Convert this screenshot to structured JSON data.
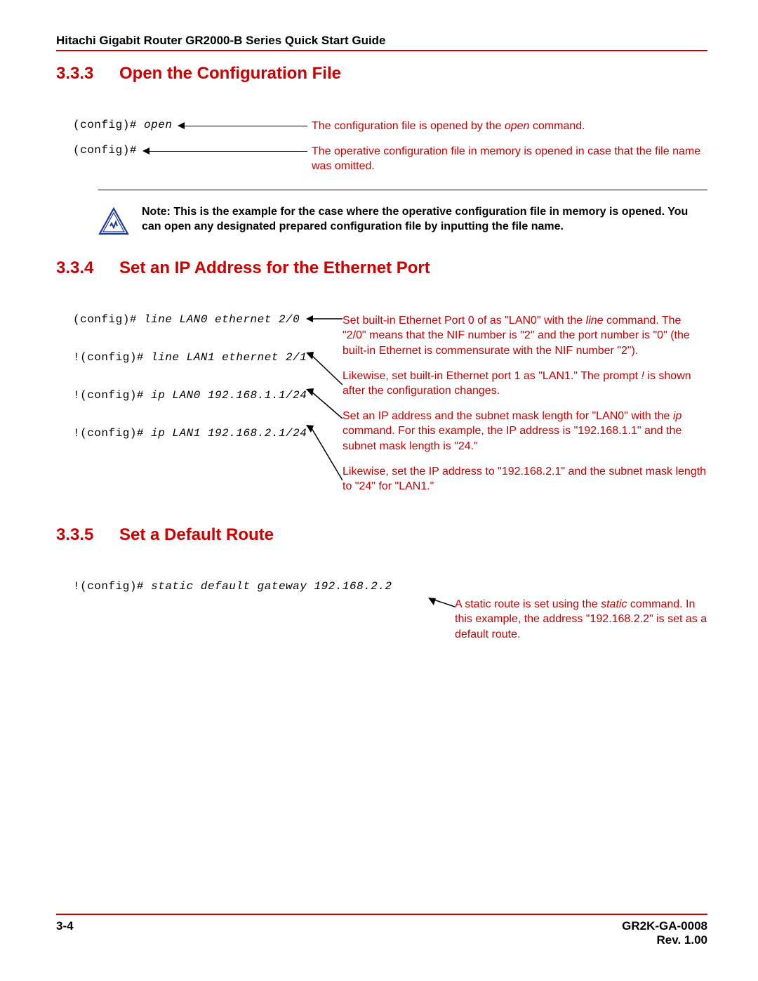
{
  "header": {
    "title": "Hitachi Gigabit Router GR2000-B Series Quick Start Guide"
  },
  "sections": {
    "s333": {
      "num": "3.3.3",
      "title": "Open the Configuration File"
    },
    "s334": {
      "num": "3.3.4",
      "title": "Set an IP Address for the Ethernet Port"
    },
    "s335": {
      "num": "3.3.5",
      "title": "Set a Default Route"
    }
  },
  "s333": {
    "cmd1_prompt": "(config)#",
    "cmd1_cmd": "open",
    "expl1_pre": "The configuration file is opened by the ",
    "expl1_it": "open",
    "expl1_post": " command.",
    "cmd2_prompt": "(config)#",
    "expl2": "The operative configuration file in memory is opened in case that the file name was omitted."
  },
  "note": {
    "label": "Note:  T",
    "body": "his is the example for the case where the operative configuration file in memory is opened. You can open any designated prepared configuration file by inputting the file name."
  },
  "s334": {
    "cmd1_prompt": "(config)# ",
    "cmd1_cmd": "line LAN0 ethernet 2/0",
    "cmd2_prompt": "!(config)# ",
    "cmd2_cmd": "line LAN1 ethernet 2/1",
    "cmd3_prompt": "!(config)# ",
    "cmd3_cmd": "ip LAN0 192.168.1.1/24",
    "cmd4_prompt": "!(config)# ",
    "cmd4_cmd": "ip LAN1 192.168.2.1/24",
    "expl1_pre": "Set built-in Ethernet Port 0 of as \"LAN0\" with the ",
    "expl1_it": "line",
    "expl1_post": " command. The \"2/0\" means that the NIF number is \"2\" and the port number is \"0\" (the built-in Ethernet is commensurate with the NIF number \"2\").",
    "expl2_pre": "Likewise, set built-in Ethernet port 1 as \"LAN1.\" The prompt ",
    "expl2_it": "!",
    "expl2_post": " is shown after the configuration changes.",
    "expl3_pre": "Set an IP address and the subnet mask length for \"LAN0\" with the ",
    "expl3_it": "ip",
    "expl3_post": " command. For this example, the IP address is \"192.168.1.1\" and the subnet mask length is \"24.\"",
    "expl4": "Likewise, set the IP address to \"192.168.2.1\" and the subnet mask length to \"24\" for \"LAN1.\""
  },
  "s335": {
    "cmd_prompt": "!(config)# ",
    "cmd_cmd": "static default gateway 192.168.2.2",
    "expl_pre": "A static route is set using the ",
    "expl_it": "static",
    "expl_post": " command. In this example, the address \"192.168.2.2\" is set as a default route."
  },
  "footer": {
    "page": "3-4",
    "docid": "GR2K-GA-0008",
    "rev": "Rev. 1.00"
  }
}
